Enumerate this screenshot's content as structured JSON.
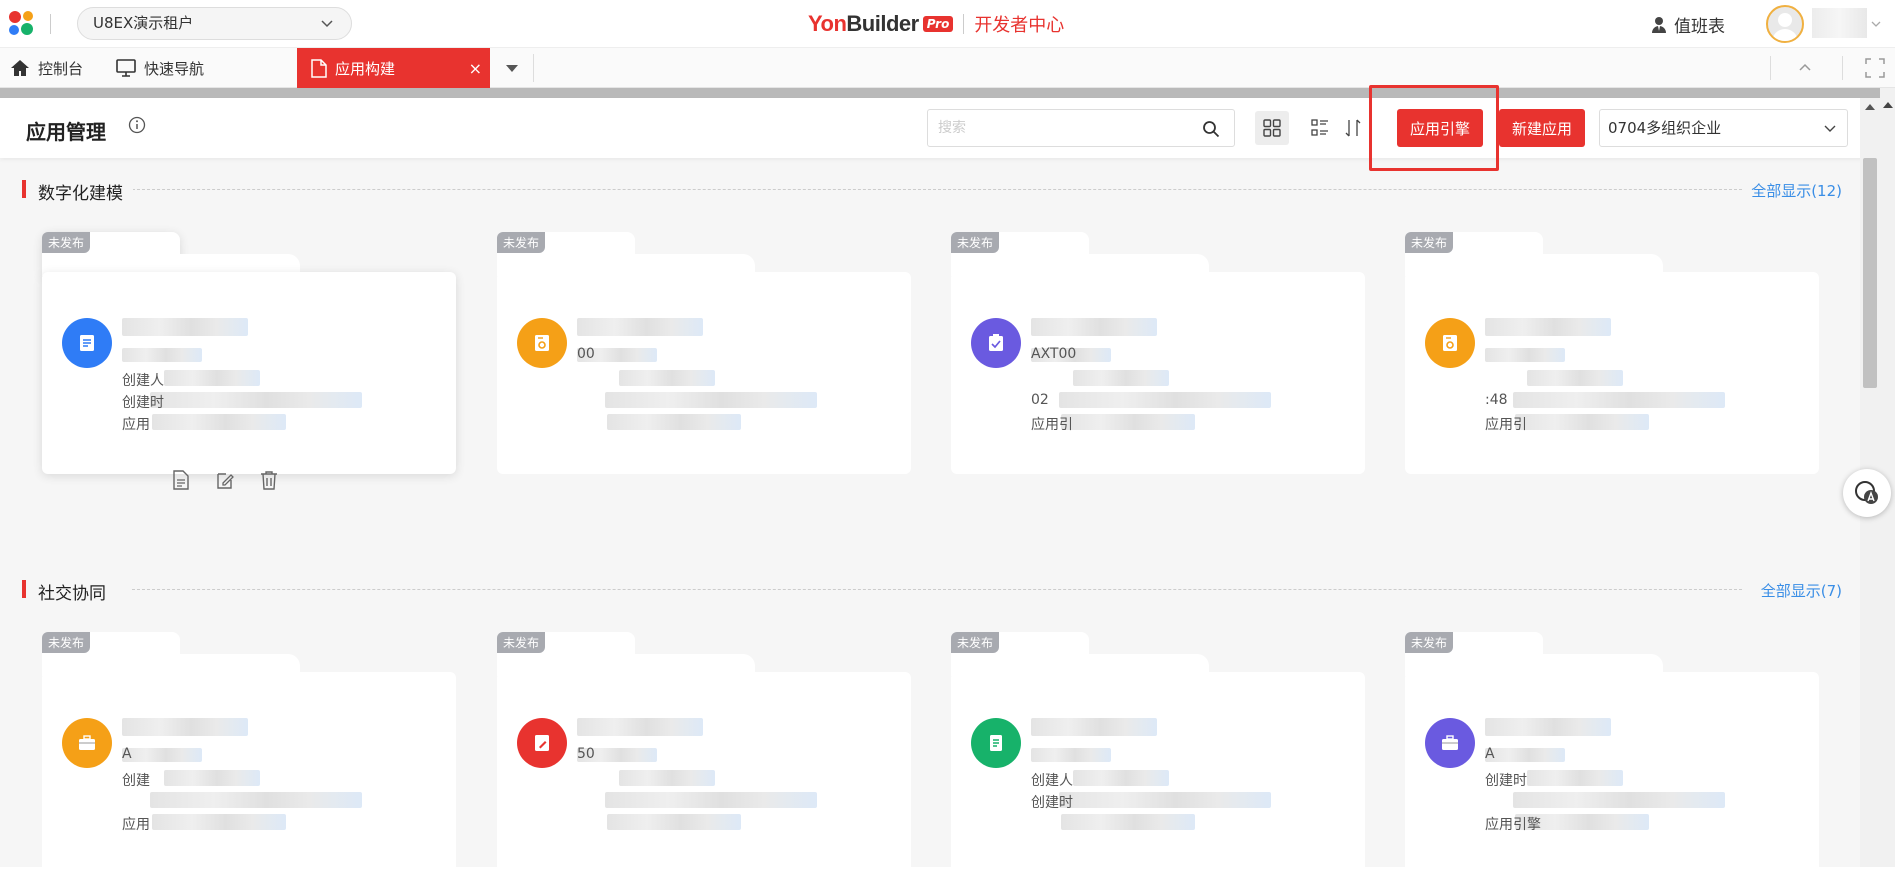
{
  "topbar": {
    "tenant": "U8EX演示租户",
    "brand_yon": "Yon",
    "brand_builder": "Builder",
    "brand_pro": "Pro",
    "dev_center": "开发者中心",
    "duty": "值班表"
  },
  "tabs": [
    {
      "label": "控制台",
      "icon": "home-icon"
    },
    {
      "label": "快速导航",
      "icon": "monitor-icon"
    },
    {
      "label": "应用构建",
      "icon": "document-icon",
      "close": "×"
    }
  ],
  "header": {
    "title": "应用管理",
    "search_placeholder": "搜索",
    "engine_button": "应用引擎",
    "new_button": "新建应用",
    "org": "0704多组织企业"
  },
  "sections": [
    {
      "title": "数字化建模",
      "more": "全部显示(12)",
      "cards": [
        {
          "badge": "未发布",
          "color": "#2f7cf6",
          "icon": "form-icon",
          "l1": "创建人",
          "l2": "创建时",
          "l3": "应用"
        },
        {
          "badge": "未发布",
          "color": "#f5a017",
          "icon": "gear-doc-icon",
          "code": "00",
          "l1": "",
          "l2": "",
          "l3": ""
        },
        {
          "badge": "未发布",
          "color": "#6a5ae0",
          "icon": "clipboard-check-icon",
          "code": "AXT00",
          "l1": "",
          "l2": "02",
          "l3": "应用引"
        },
        {
          "badge": "未发布",
          "color": "#f5a017",
          "icon": "gear-doc-icon",
          "code": "",
          "l1": "",
          "l2": ":48",
          "l3": "应用引"
        }
      ]
    },
    {
      "title": "社交协同",
      "more": "全部显示(7)",
      "cards": [
        {
          "badge": "未发布",
          "color": "#f5a017",
          "icon": "briefcase-icon",
          "code": "A",
          "l1": "创建",
          "l2": "",
          "l3": "应用"
        },
        {
          "badge": "未发布",
          "color": "#e8332f",
          "icon": "edit-doc-icon",
          "code": "50",
          "l1": "",
          "l2": "",
          "l3": ""
        },
        {
          "badge": "未发布",
          "color": "#17b26a",
          "icon": "doc-lines-icon",
          "code": "",
          "l1": "创建人",
          "l2": "创建时",
          "l3": ""
        },
        {
          "badge": "未发布",
          "color": "#6a5ae0",
          "icon": "briefcase-icon",
          "code": "A",
          "l1": "创建时",
          "l2": "",
          "l3": "应用引擎"
        }
      ]
    }
  ],
  "colors": {
    "brand_red": "#e8332f",
    "link_blue": "#3a8ee6"
  }
}
